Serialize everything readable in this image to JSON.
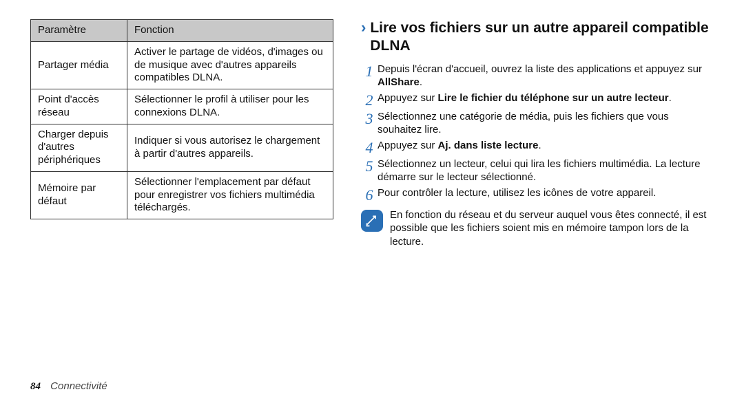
{
  "table": {
    "headers": [
      "Paramètre",
      "Fonction"
    ],
    "rows": [
      {
        "param": "Partager média",
        "func": "Activer le partage de vidéos, d'images ou de musique avec d'autres appareils compatibles DLNA."
      },
      {
        "param": "Point d'accès réseau",
        "func": "Sélectionner le profil à utiliser pour les connexions DLNA."
      },
      {
        "param": "Charger depuis d'autres périphériques",
        "func": "Indiquer si vous autorisez le chargement à partir d'autres appareils."
      },
      {
        "param": "Mémoire par défaut",
        "func": "Sélectionner l'emplacement par défaut pour enregistrer vos fichiers multimédia téléchargés."
      }
    ]
  },
  "heading": "Lire vos fichiers sur un autre appareil compatible DLNA",
  "steps": [
    {
      "n": "1",
      "before": "Depuis l'écran d'accueil, ouvrez la liste des applications et appuyez sur ",
      "bold": "AllShare",
      "after": "."
    },
    {
      "n": "2",
      "before": "Appuyez sur ",
      "bold": "Lire le fichier du téléphone sur un autre lecteur",
      "after": "."
    },
    {
      "n": "3",
      "before": "Sélectionnez une catégorie de média, puis les fichiers que vous souhaitez lire.",
      "bold": "",
      "after": ""
    },
    {
      "n": "4",
      "before": "Appuyez sur ",
      "bold": "Aj. dans liste lecture",
      "after": "."
    },
    {
      "n": "5",
      "before": "Sélectionnez un lecteur, celui qui lira les fichiers multimédia. La lecture démarre sur le lecteur sélectionné.",
      "bold": "",
      "after": ""
    },
    {
      "n": "6",
      "before": "Pour contrôler la lecture, utilisez les icônes de votre appareil.",
      "bold": "",
      "after": ""
    }
  ],
  "note": "En fonction du réseau et du serveur auquel vous êtes connecté, il est possible que les fichiers soient mis en mémoire tampon lors de la lecture.",
  "footer": {
    "page": "84",
    "section": "Connectivité"
  }
}
